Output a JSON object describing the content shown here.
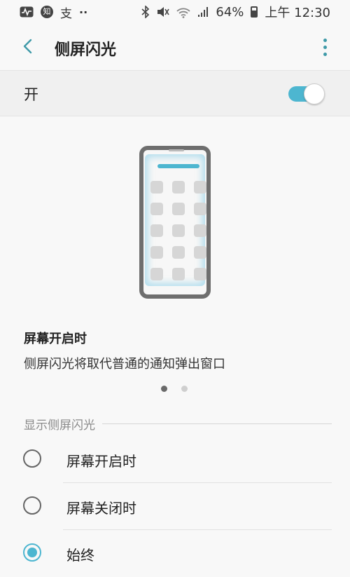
{
  "status_bar": {
    "left_icons": [
      "activity-icon",
      "zhihu-icon",
      "alipay-icon",
      "more-notifications-icon"
    ],
    "zhihu_glyph": "知",
    "alipay_glyph": "支",
    "more_glyph": "··",
    "right_icons": [
      "bluetooth-icon",
      "mute-icon",
      "wifi-4g-icon",
      "signal-icon",
      "battery-icon"
    ],
    "battery": "64%",
    "battery_level": 0.64,
    "time": "上午 12:30"
  },
  "app_bar": {
    "title": "侧屏闪光",
    "back_icon": "back-arrow-icon",
    "menu_icon": "more-vert-icon"
  },
  "master_switch": {
    "label": "开",
    "state": "on",
    "accent_color": "#4db6d0"
  },
  "illustration": {
    "caption_title": "屏幕开启时",
    "caption_desc": "侧屏闪光将取代普通的通知弹出窗口",
    "pages": 2,
    "current_page": 1
  },
  "section": {
    "header": "显示侧屏闪光",
    "options": [
      {
        "label": "屏幕开启时",
        "selected": false
      },
      {
        "label": "屏幕关闭时",
        "selected": false
      },
      {
        "label": "始终",
        "selected": true
      }
    ]
  }
}
